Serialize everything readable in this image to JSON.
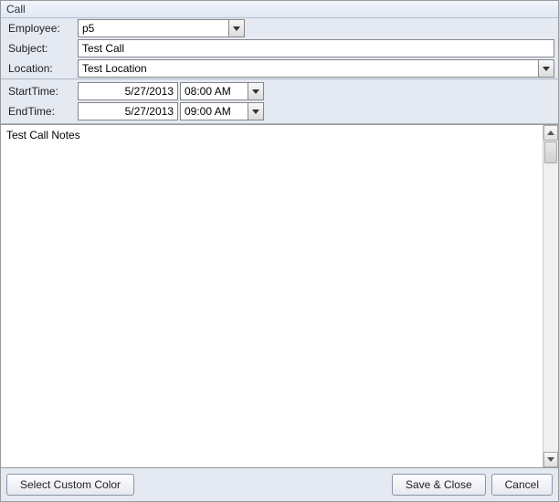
{
  "title": "Call",
  "labels": {
    "employee": "Employee:",
    "subject": "Subject:",
    "location": "Location:",
    "starttime": "StartTime:",
    "endtime": "EndTime:"
  },
  "fields": {
    "employee": "p5",
    "subject": "Test Call",
    "location": "Test Location",
    "start_date": "5/27/2013",
    "start_time": "08:00 AM",
    "end_date": "5/27/2013",
    "end_time": "09:00 AM",
    "notes": "Test Call Notes"
  },
  "buttons": {
    "custom_color": "Select Custom Color",
    "save_close": "Save & Close",
    "cancel": "Cancel"
  }
}
